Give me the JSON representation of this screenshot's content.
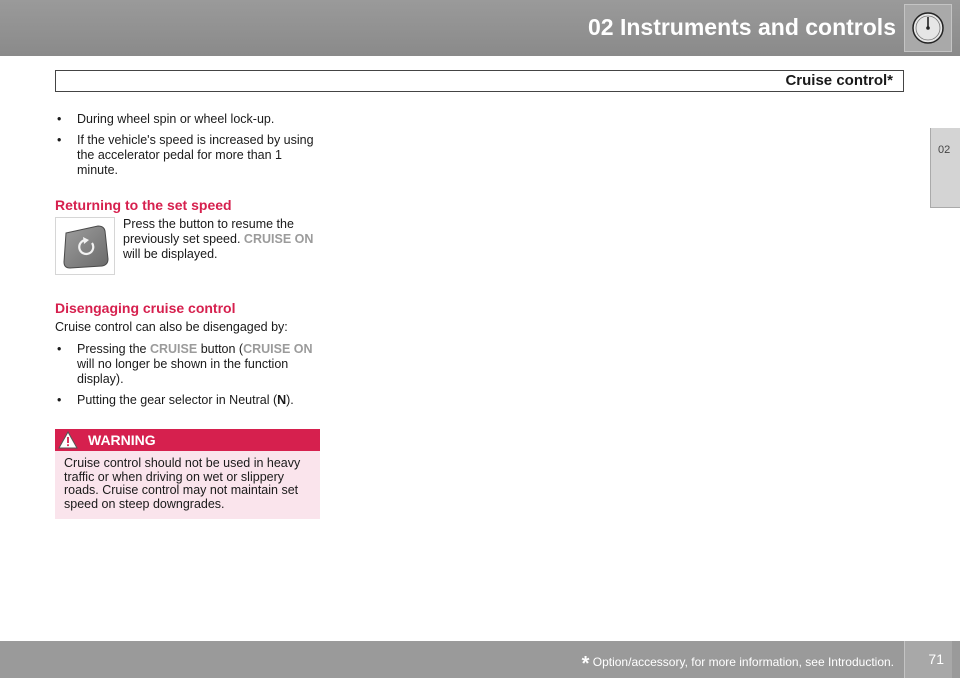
{
  "header": {
    "title": "02 Instruments and controls",
    "icon": "gauge-icon"
  },
  "section": {
    "title": "Cruise control*"
  },
  "side_tab": {
    "label": "02"
  },
  "bullets_top": [
    "During wheel spin or wheel lock-up.",
    "If the vehicle's speed is increased by using the accelerator pedal for more than 1 minute."
  ],
  "returning": {
    "heading": "Returning to the set speed",
    "text_before": "Press the button to resume the previously set speed.",
    "highlight": "CRUISE ON",
    "text_after": "will be displayed.",
    "button_icon": "resume-button-icon"
  },
  "disengaging": {
    "heading": "Disengaging cruise control",
    "intro": "Cruise control can also be disengaged by:",
    "bullet1_a": "Pressing the",
    "bullet1_hl1": "CRUISE",
    "bullet1_b": "button (",
    "bullet1_hl2": "CRUISE ON",
    "bullet1_c": "will no longer be shown in the function display).",
    "bullet2_a": "Putting the gear selector in Neutral (",
    "bullet2_bold": "N",
    "bullet2_b": ")."
  },
  "warning": {
    "title": "WARNING",
    "text": "Cruise control should not be used in heavy traffic or when driving on wet or slippery roads. Cruise control may not maintain set speed on steep downgrades."
  },
  "footer": {
    "star": "*",
    "note": "Option/accessory, for more information, see Introduction.",
    "page": "71"
  },
  "colors": {
    "accent_red": "#d6204e",
    "highlight_grey": "#9b9b9b",
    "bar_grey": "#9a9a9a"
  }
}
